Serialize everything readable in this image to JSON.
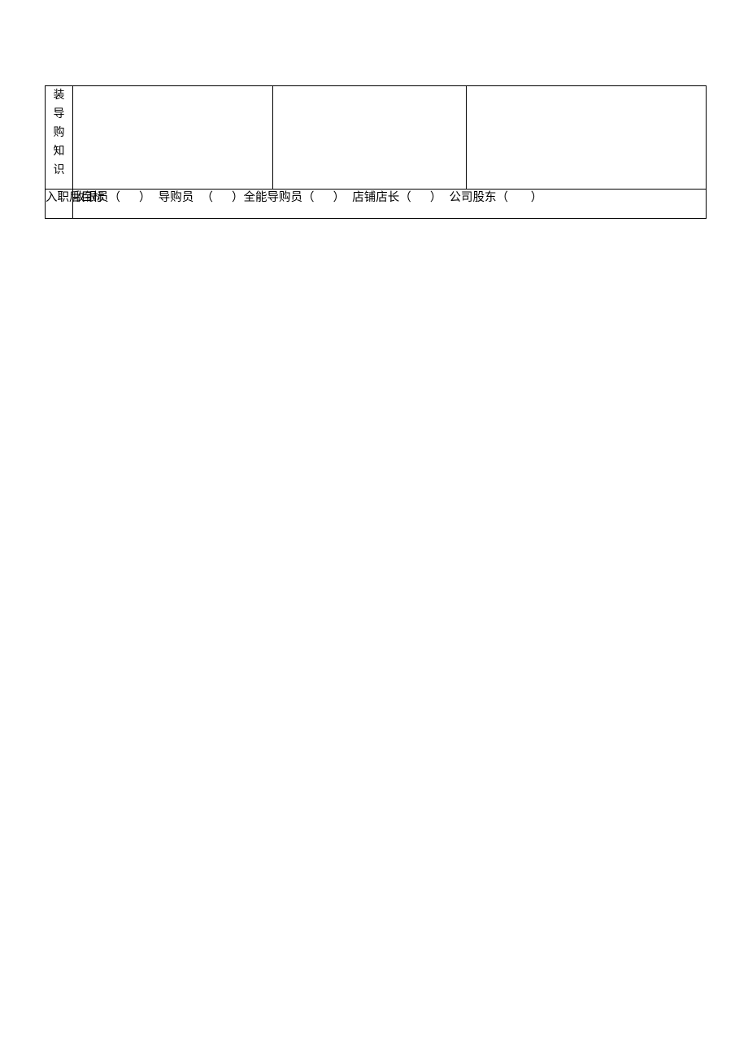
{
  "document": {
    "page_background": "#ffffff",
    "text_color": "#000000",
    "border_color": "#000000"
  },
  "table": {
    "rows": [
      {
        "name": "knowledge-row",
        "vertical_label": "装\n导\n购\n知\n识",
        "vertical_label_chars": [
          "装",
          "导",
          "购",
          "知",
          "识"
        ],
        "cells": [
          "",
          "",
          ""
        ]
      },
      {
        "name": "goal-row",
        "label": "入职后目标",
        "options_text": "收银员（     ）  导购员  （     ）全能导购员（     ）  店铺店长（     ）  公司股东（      ）",
        "options": [
          {
            "label": "收银员",
            "bracket": "（     ）",
            "checked": ""
          },
          {
            "label": "导购员",
            "bracket": "（     ）",
            "checked": ""
          },
          {
            "label": "全能导购员",
            "bracket": "（     ）",
            "checked": ""
          },
          {
            "label": "店铺店长",
            "bracket": "（     ）",
            "checked": ""
          },
          {
            "label": "公司股东",
            "bracket": "（      ）",
            "checked": ""
          }
        ]
      }
    ]
  }
}
